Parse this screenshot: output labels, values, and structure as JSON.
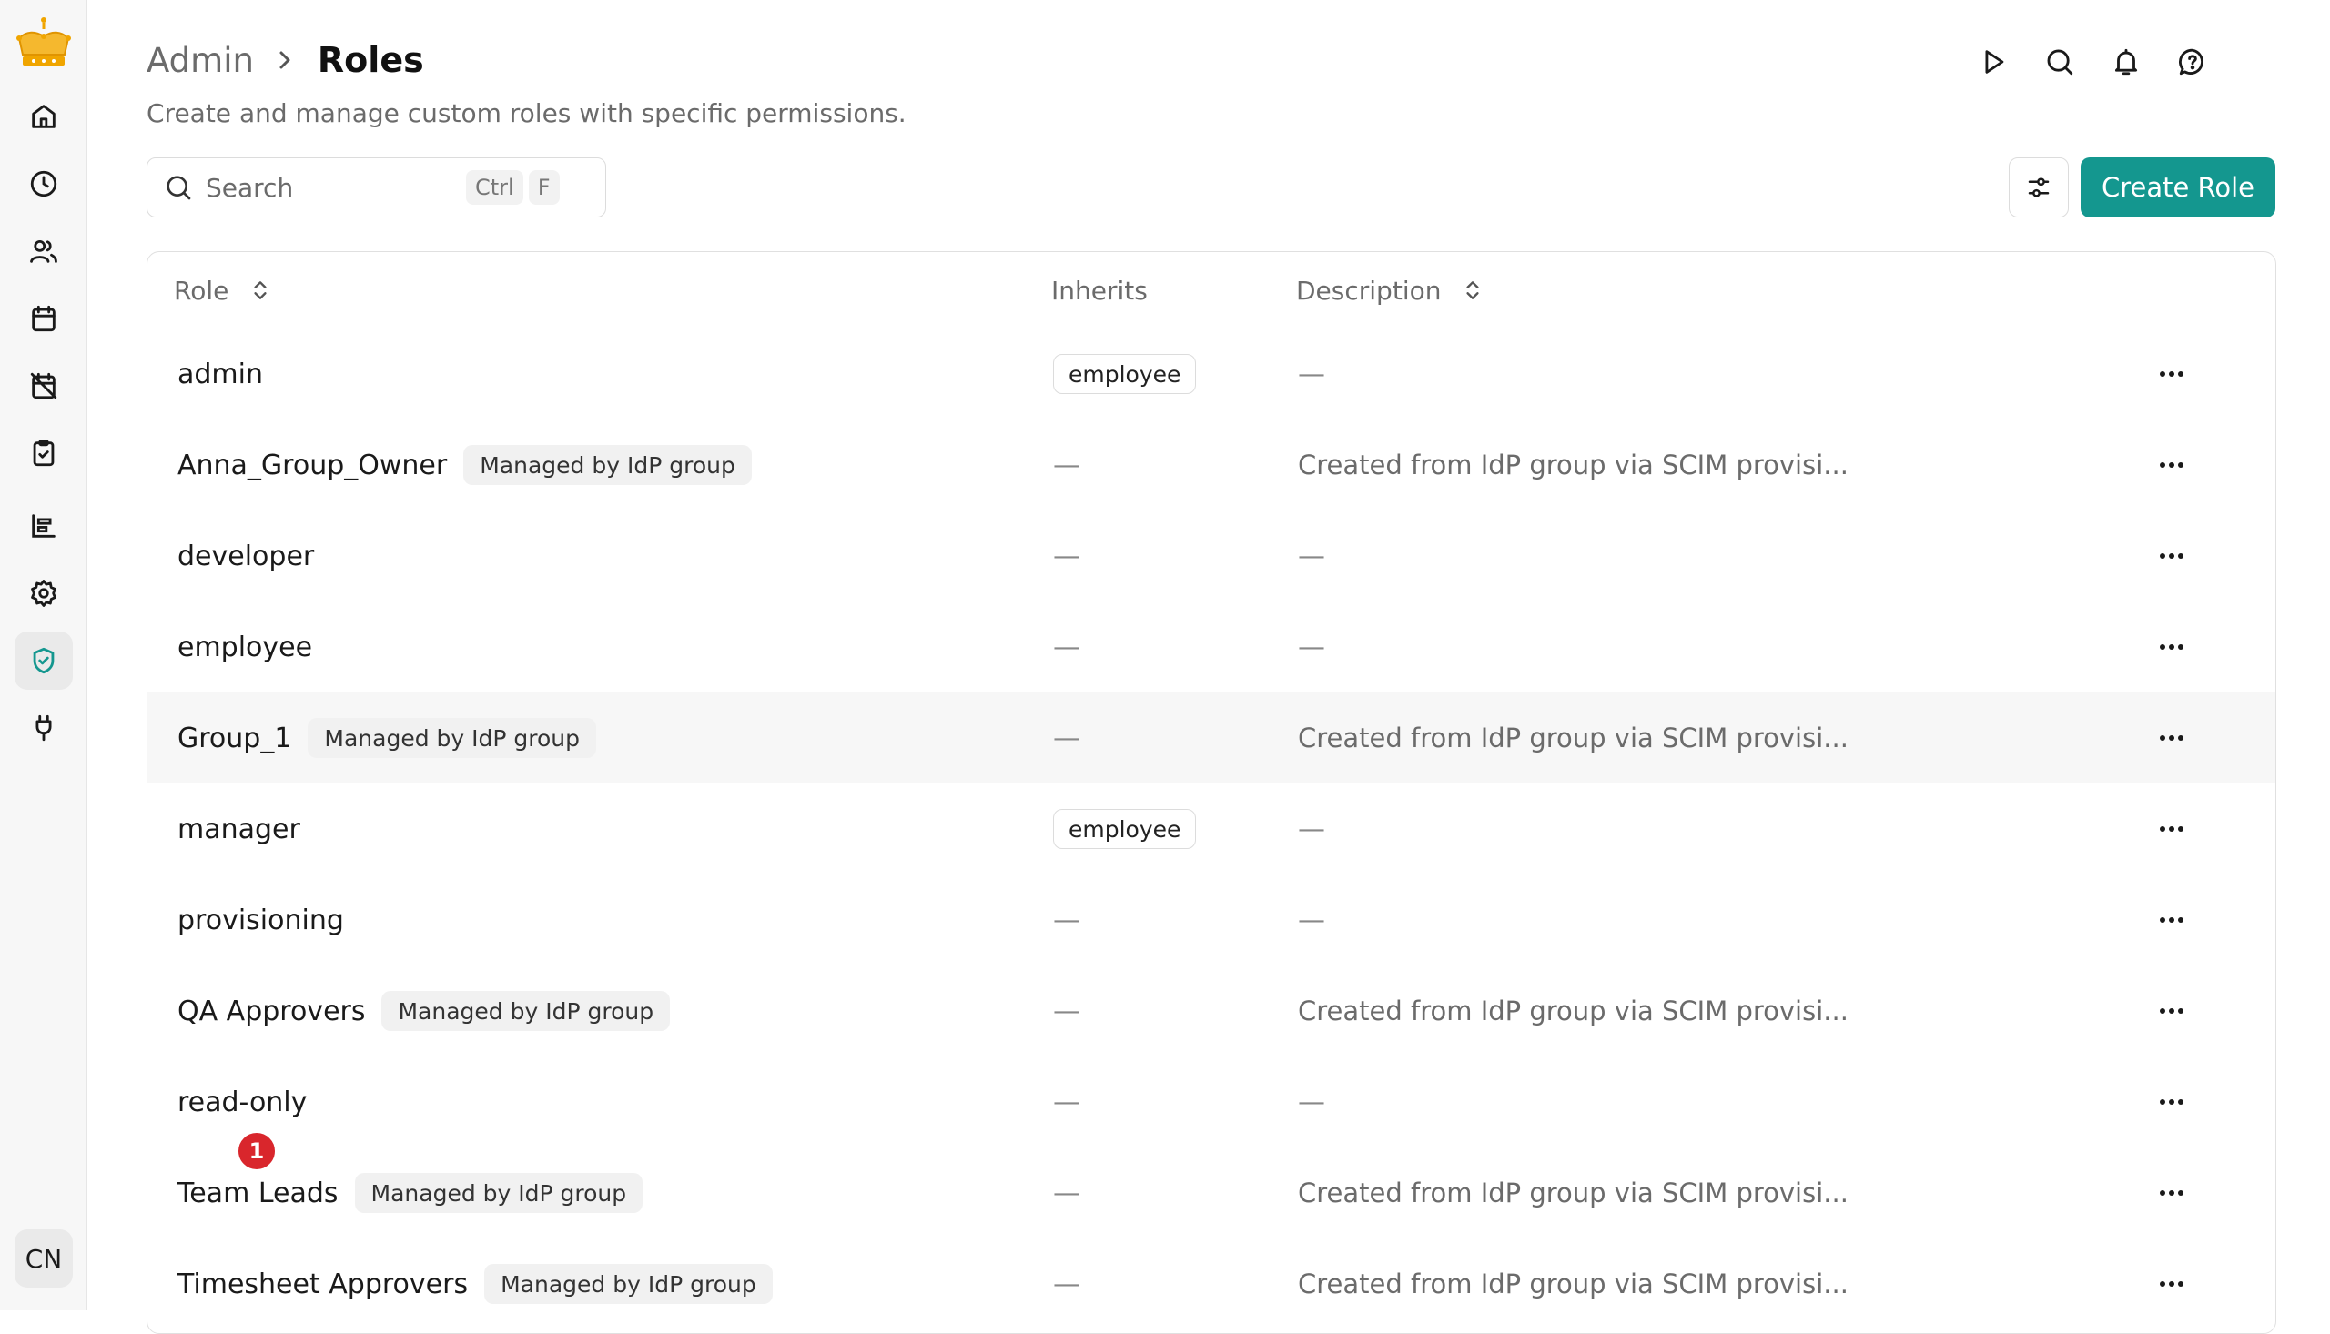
{
  "sidebar": {
    "logo": "crown-logo",
    "items": [
      {
        "name": "home",
        "icon": "home-icon"
      },
      {
        "name": "history",
        "icon": "clock-icon"
      },
      {
        "name": "people",
        "icon": "users-icon"
      },
      {
        "name": "calendar",
        "icon": "calendar-icon"
      },
      {
        "name": "calendar-off",
        "icon": "calendar-off-icon"
      },
      {
        "name": "tasks",
        "icon": "clipboard-check-icon"
      },
      {
        "name": "reports",
        "icon": "chart-bars-icon"
      },
      {
        "name": "settings",
        "icon": "gear-icon"
      },
      {
        "name": "security",
        "icon": "shield-check-icon",
        "active": true
      },
      {
        "name": "integrations",
        "icon": "plug-icon"
      }
    ],
    "user_initials": "CN"
  },
  "header": {
    "breadcrumb_parent": "Admin",
    "breadcrumb_current": "Roles",
    "subtitle": "Create and manage custom roles with specific permissions.",
    "icons": [
      "play-icon",
      "search-icon",
      "bell-icon",
      "help-icon"
    ]
  },
  "toolbar": {
    "search_placeholder": "Search",
    "search_shortcut": [
      "Ctrl",
      "F"
    ],
    "create_label": "Create Role"
  },
  "table": {
    "columns": {
      "role": "Role",
      "inherits": "Inherits",
      "description": "Description"
    },
    "rows": [
      {
        "role": "admin",
        "tag": "",
        "inherits": "employee",
        "description": "—"
      },
      {
        "role": "Anna_Group_Owner",
        "tag": "Managed by IdP group",
        "inherits": "—",
        "description": "Created from IdP group via SCIM provisi..."
      },
      {
        "role": "developer",
        "tag": "",
        "inherits": "—",
        "description": "—"
      },
      {
        "role": "employee",
        "tag": "",
        "inherits": "—",
        "description": "—"
      },
      {
        "role": "Group_1",
        "tag": "Managed by IdP group",
        "inherits": "—",
        "description": "Created from IdP group via SCIM provisi..."
      },
      {
        "role": "manager",
        "tag": "",
        "inherits": "employee",
        "description": "—"
      },
      {
        "role": "provisioning",
        "tag": "",
        "inherits": "—",
        "description": "—"
      },
      {
        "role": "QA Approvers",
        "tag": "Managed by IdP group",
        "inherits": "—",
        "description": "Created from IdP group via SCIM provisi..."
      },
      {
        "role": "read-only",
        "tag": "",
        "inherits": "—",
        "description": "—"
      },
      {
        "role": "Team Leads",
        "tag": "Managed by IdP group",
        "inherits": "—",
        "description": "Created from IdP group via SCIM provisi..."
      },
      {
        "role": "Timesheet Approvers",
        "tag": "Managed by IdP group",
        "inherits": "—",
        "description": "Created from IdP group via SCIM provisi..."
      }
    ]
  },
  "notification_badge": "1",
  "colors": {
    "accent": "#14978f",
    "badge": "#d9262c",
    "logo": "#f0a500"
  }
}
